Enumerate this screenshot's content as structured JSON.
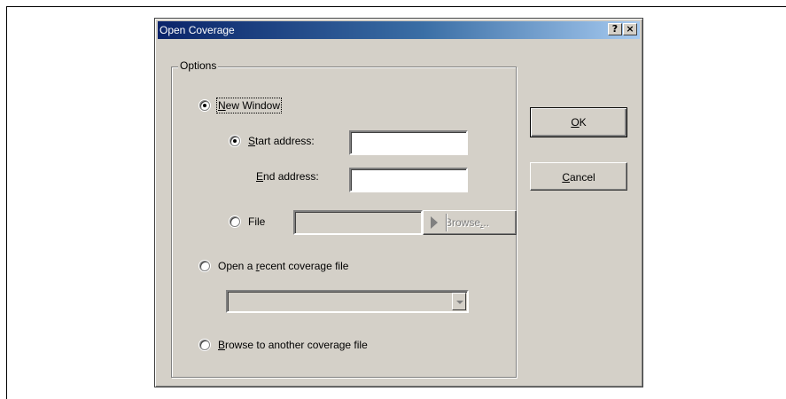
{
  "dialog": {
    "title": "Open Coverage",
    "help_glyph": "?",
    "close_glyph": "×"
  },
  "options": {
    "group_label": "Options",
    "new_window": {
      "prefix": "",
      "underline": "N",
      "rest": "ew Window",
      "checked": true
    },
    "start_address": {
      "underline": "S",
      "rest": "tart address:",
      "value": "",
      "checked": true
    },
    "end_address": {
      "underline": "E",
      "rest": "nd address:",
      "value": ""
    },
    "file": {
      "label": "File",
      "value": "",
      "checked": false
    },
    "browse_button": {
      "label_pre": "Browse",
      "label_u": ".",
      "label_post": ".."
    },
    "open_recent": {
      "prefix": "Open a ",
      "underline": "r",
      "rest": "ecent coverage file",
      "checked": false
    },
    "recent_combo_value": "",
    "browse_another": {
      "prefix": "",
      "underline": "B",
      "rest": "rowse to another coverage file",
      "checked": false
    }
  },
  "buttons": {
    "ok": {
      "underline": "O",
      "rest": "K"
    },
    "cancel": {
      "underline": "C",
      "rest": "ancel"
    }
  }
}
